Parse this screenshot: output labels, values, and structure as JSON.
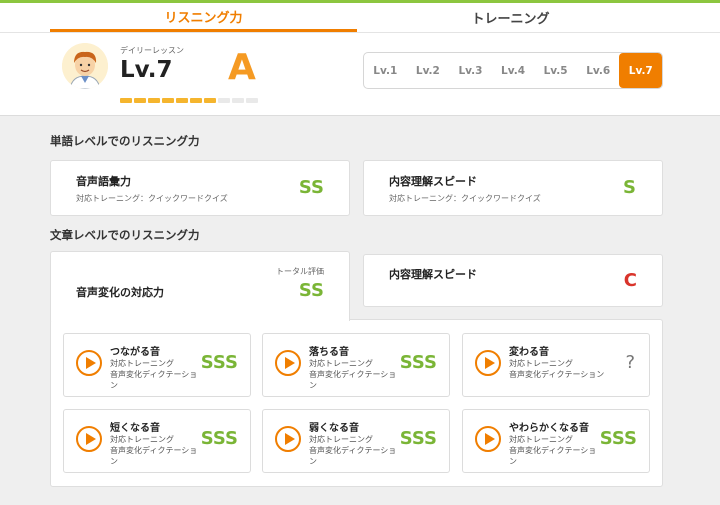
{
  "tabs": [
    {
      "label": "リスニング力"
    },
    {
      "label": "トレーニング"
    }
  ],
  "header": {
    "lesson_label": "デイリーレッスン",
    "level": "Lv.7",
    "grade": "A",
    "progress_fraction": 0.7,
    "level_tabs": [
      "Lv.1",
      "Lv.2",
      "Lv.3",
      "Lv.4",
      "Lv.5",
      "Lv.6",
      "Lv.7"
    ],
    "active_level": "Lv.7"
  },
  "word_section": {
    "title": "単語レベルでのリスニング力",
    "vocab": {
      "title": "音声語彙力",
      "sub": "対応トレーニング：クイックワードクイズ",
      "score": "SS"
    },
    "speed": {
      "title": "内容理解スピード",
      "sub": "対応トレーニング：クイックワードクイズ",
      "score": "S"
    }
  },
  "sentence_section": {
    "title": "文章レベルでのリスニング力",
    "change": {
      "title": "音声変化の対応力",
      "total_label": "トータル評価",
      "score": "SS"
    },
    "speed": {
      "title": "内容理解スピード",
      "score": "C"
    },
    "items": [
      {
        "title": "つながる音",
        "sub1": "対応トレーニング",
        "sub2": "音声変化ディクテーショ",
        "sub3": "ン",
        "score": "SSS"
      },
      {
        "title": "落ちる音",
        "sub1": "対応トレーニング",
        "sub2": "音声変化ディクテーショ",
        "sub3": "ン",
        "score": "SSS"
      },
      {
        "title": "変わる音",
        "sub1": "対応トレーニング",
        "sub2": "音声変化ディクテーション",
        "sub3": "",
        "score": "?"
      },
      {
        "title": "短くなる音",
        "sub1": "対応トレーニング",
        "sub2": "音声変化ディクテーショ",
        "sub3": "ン",
        "score": "SSS"
      },
      {
        "title": "弱くなる音",
        "sub1": "対応トレーニング",
        "sub2": "音声変化ディクテーショ",
        "sub3": "ン",
        "score": "SSS"
      },
      {
        "title": "やわらかくなる音",
        "sub1": "対応トレーニング",
        "sub2": "音声変化ディクテーショ",
        "sub3": "ン",
        "score": "SSS"
      }
    ]
  },
  "colors": {
    "accent": "#f07e00",
    "good": "#7ab536",
    "bad": "#d9342b",
    "grade": "#f59a23"
  }
}
